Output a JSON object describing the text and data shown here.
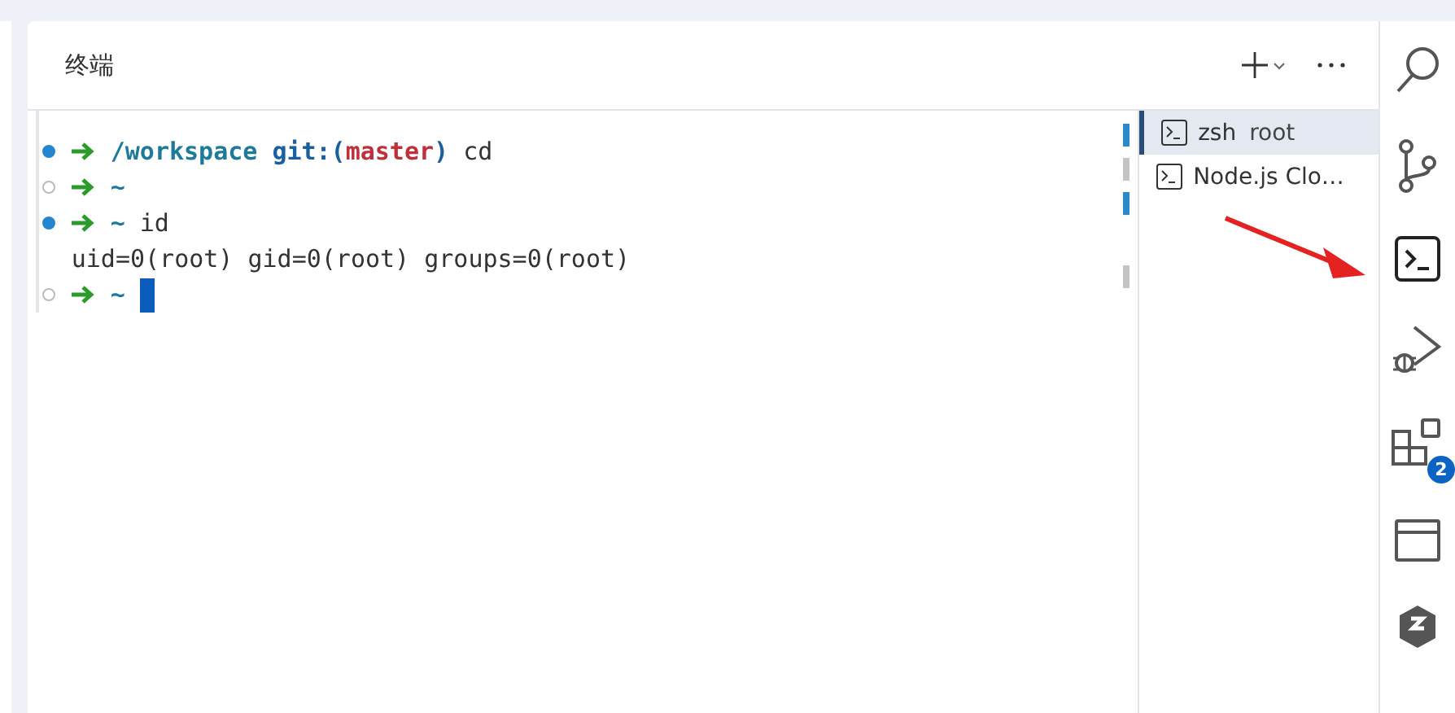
{
  "panel": {
    "title": "终端"
  },
  "terminal": {
    "lines": [
      {
        "kind": "prompt",
        "succeeded": true,
        "segments": [
          {
            "kind": "path",
            "text": "/workspace"
          },
          {
            "kind": "git",
            "text": "git:("
          },
          {
            "kind": "branch",
            "text": "master"
          },
          {
            "kind": "git_end",
            "text": ")"
          },
          {
            "kind": "command",
            "text": "cd"
          }
        ]
      },
      {
        "kind": "prompt",
        "succeeded": false,
        "segments": [
          {
            "kind": "path",
            "text": "~"
          }
        ]
      },
      {
        "kind": "prompt",
        "succeeded": true,
        "segments": [
          {
            "kind": "path",
            "text": "~"
          },
          {
            "kind": "command",
            "text": "id"
          }
        ]
      },
      {
        "kind": "output",
        "text": "uid=0(root) gid=0(root) groups=0(root)"
      },
      {
        "kind": "prompt",
        "succeeded": false,
        "cursor": true,
        "segments": [
          {
            "kind": "path",
            "text": "~"
          }
        ]
      }
    ]
  },
  "terminal_tabs": [
    {
      "label": "zsh",
      "detail": "root",
      "selected": true
    },
    {
      "label": "Node.js Clo…",
      "selected": false
    }
  ],
  "activity_bar": {
    "extensions_badge": "2"
  }
}
